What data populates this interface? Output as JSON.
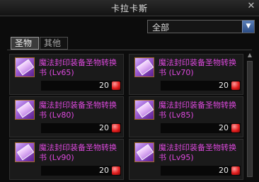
{
  "window": {
    "title": "卡拉卡斯",
    "close_glyph": "✕"
  },
  "filter": {
    "selected": "全部",
    "arrow_glyph": "▼"
  },
  "tabs": [
    {
      "label": "圣物"
    },
    {
      "label": "其他"
    }
  ],
  "items": [
    {
      "name": "魔法封印装备圣物转换书 (Lv65)",
      "price": "20",
      "currency_icon": "red-gem-icon"
    },
    {
      "name": "魔法封印装备圣物转换书 (Lv70)",
      "price": "20",
      "currency_icon": "red-gem-icon"
    },
    {
      "name": "魔法封印装备圣物转换书 (Lv80)",
      "price": "20",
      "currency_icon": "red-gem-icon"
    },
    {
      "name": "魔法封印装备圣物转换书 (Lv85)",
      "price": "20",
      "currency_icon": "red-gem-icon"
    },
    {
      "name": "魔法封印装备圣物转换书 (Lv90)",
      "price": "20",
      "currency_icon": "red-gem-icon"
    },
    {
      "name": "魔法封印装备圣物转换书 (Lv95)",
      "price": "20",
      "currency_icon": "red-gem-icon"
    }
  ],
  "colors": {
    "item_name": "#dd49de",
    "dropdown_accent": "#2b4c85",
    "currency_gem": "#e11d1d"
  }
}
